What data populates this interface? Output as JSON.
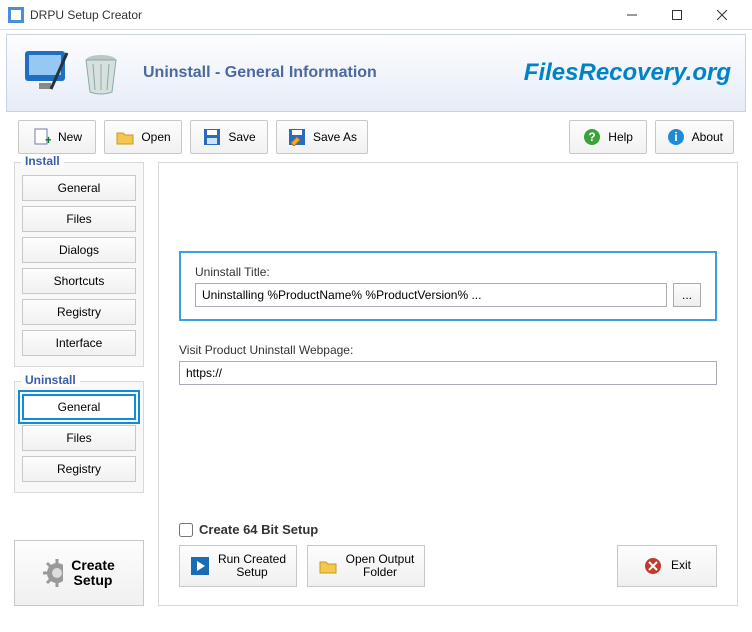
{
  "window": {
    "title": "DRPU Setup Creator"
  },
  "banner": {
    "title": "Uninstall - General Information",
    "brand": "FilesRecovery.org"
  },
  "toolbar": {
    "new_label": "New",
    "open_label": "Open",
    "save_label": "Save",
    "save_as_label": "Save As",
    "help_label": "Help",
    "about_label": "About"
  },
  "sidebar": {
    "install_label": "Install",
    "install_items": [
      "General",
      "Files",
      "Dialogs",
      "Shortcuts",
      "Registry",
      "Interface"
    ],
    "uninstall_label": "Uninstall",
    "uninstall_items": [
      "General",
      "Files",
      "Registry"
    ],
    "create_label": "Create\nSetup"
  },
  "form": {
    "uninstall_title_label": "Uninstall Title:",
    "uninstall_title_value": "Uninstalling %ProductName% %ProductVersion% ...",
    "browse_label": "...",
    "webpage_label": "Visit Product Uninstall Webpage:",
    "webpage_value": "https://"
  },
  "footer": {
    "create64_label": "Create 64 Bit Setup",
    "run_label": "Run Created\nSetup",
    "open_output_label": "Open Output\nFolder",
    "exit_label": "Exit"
  }
}
